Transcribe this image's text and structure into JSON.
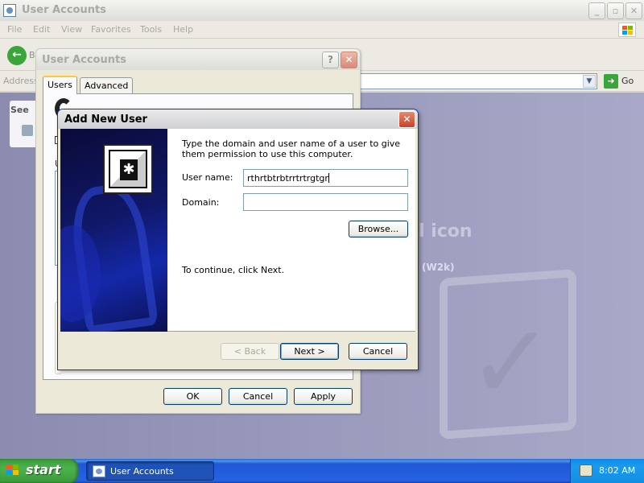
{
  "main_window": {
    "title": "User Accounts",
    "menu": [
      "File",
      "Edit",
      "View",
      "Favorites",
      "Tools",
      "Help"
    ],
    "toolbar": {
      "back_label": "B"
    },
    "address": {
      "label": "Address",
      "go_label": "Go"
    },
    "left_pane": {
      "heading": "See"
    },
    "background_text": {
      "main": "l icon",
      "sub": "(W2k)"
    }
  },
  "ua_dialog": {
    "title": "User Accounts",
    "tabs": [
      "Users",
      "Advanced"
    ],
    "fragment_label": "U",
    "buttons": {
      "ok": "OK",
      "cancel": "Cancel",
      "apply": "Apply"
    }
  },
  "add_new_user": {
    "title": "Add New User",
    "intro": "Type the domain and user name of a user to give them permission to use this computer.",
    "username_label": "User name:",
    "username_value": "rthrtbtrbtrrtrtrgtgr",
    "domain_label": "Domain:",
    "domain_value": "",
    "browse_label": "Browse...",
    "continue_text": "To continue, click Next.",
    "buttons": {
      "back": "< Back",
      "next": "Next >",
      "cancel": "Cancel"
    }
  },
  "taskbar": {
    "start_label": "start",
    "task_label": "User Accounts",
    "clock": "8:02 AM"
  }
}
